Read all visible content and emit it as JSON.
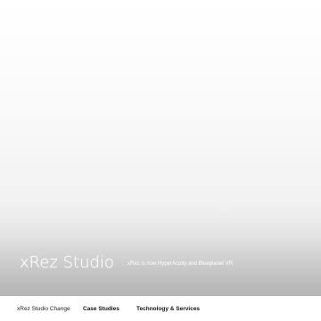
{
  "hero": {
    "title": "xRez Studio",
    "tagline": "xRez is now HyperAcuity and Blueplanet VR"
  },
  "nav": {
    "items": [
      {
        "label": "xRez Studio Change"
      },
      {
        "label": "Case Studies"
      },
      {
        "label": "Technology & Services"
      }
    ]
  },
  "colors": {
    "gradient_top": "#ffffff",
    "gradient_bottom": "#b4b4b4",
    "text_on_hero": "#ffffff",
    "nav_text": "#111111"
  }
}
